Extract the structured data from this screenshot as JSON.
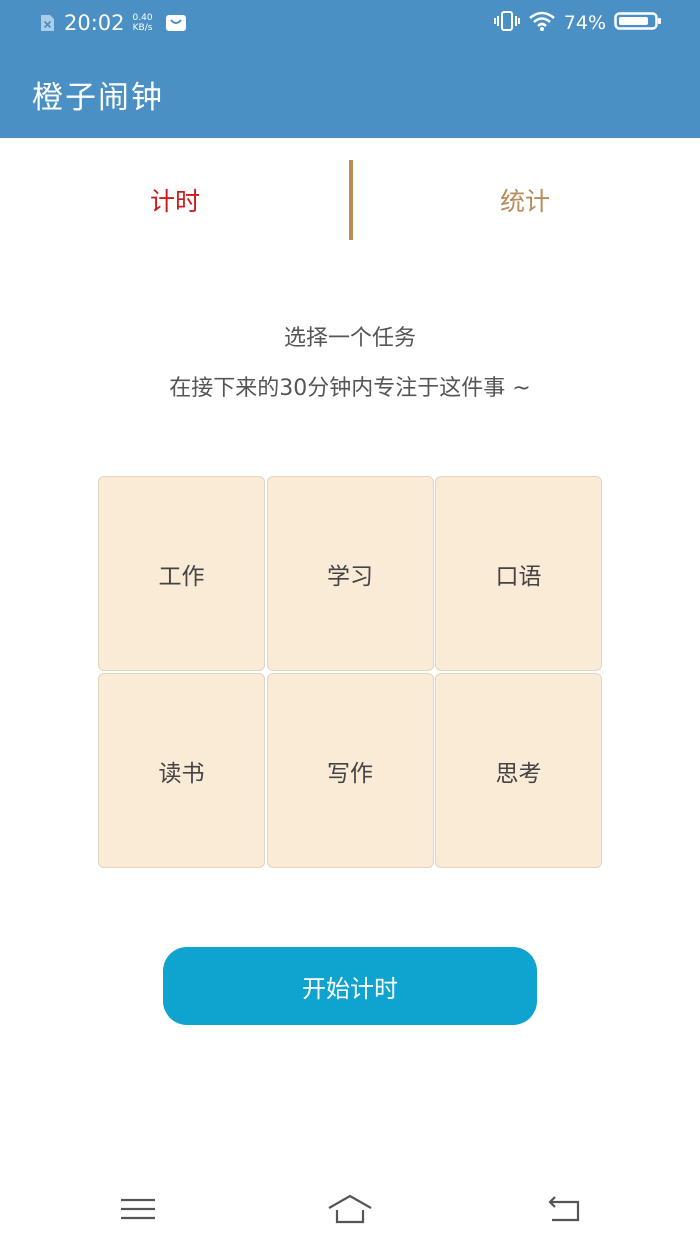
{
  "status_bar": {
    "time": "20:02",
    "speed_value": "0.40",
    "speed_unit": "KB/s",
    "battery": "74%",
    "icons": [
      "sim-missing-icon",
      "mail-icon",
      "vibrate-icon",
      "wifi-icon",
      "battery-icon"
    ]
  },
  "app_bar": {
    "title": "橙子闹钟"
  },
  "tabs": [
    {
      "label": "计时",
      "active": true
    },
    {
      "label": "统计",
      "active": false
    }
  ],
  "intro": {
    "line1": "选择一个任务",
    "line2": "在接下来的30分钟内专注于这件事 ~"
  },
  "tasks": [
    "工作",
    "学习",
    "口语",
    "读书",
    "写作",
    "思考"
  ],
  "start_button": "开始计时",
  "nav_bar": {
    "icons": [
      "menu-icon",
      "home-icon",
      "back-icon"
    ]
  },
  "colors": {
    "app_bar": "#4a90c4",
    "active_tab": "#d11a1a",
    "inactive_tab": "#b88c5a",
    "task_tile": "#faebd7",
    "start_button": "#0fa3cf"
  }
}
